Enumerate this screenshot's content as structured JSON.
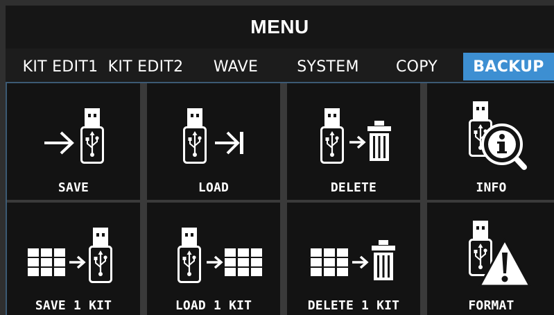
{
  "header": {
    "title": "MENU"
  },
  "tabs": [
    {
      "label": "KIT EDIT1",
      "active": false
    },
    {
      "label": "KIT EDIT2",
      "active": false
    },
    {
      "label": "WAVE",
      "active": false
    },
    {
      "label": "SYSTEM",
      "active": false
    },
    {
      "label": "COPY",
      "active": false
    },
    {
      "label": "BACKUP",
      "active": true
    }
  ],
  "tiles": [
    {
      "label": "SAVE",
      "icon": "usb-save-icon"
    },
    {
      "label": "LOAD",
      "icon": "usb-load-icon"
    },
    {
      "label": "DELETE",
      "icon": "usb-delete-icon"
    },
    {
      "label": "INFO",
      "icon": "usb-info-icon"
    },
    {
      "label": "SAVE 1 KIT",
      "icon": "save-kit-to-usb-icon"
    },
    {
      "label": "LOAD 1 KIT",
      "icon": "load-kit-from-usb-icon"
    },
    {
      "label": "DELETE 1 KIT",
      "icon": "delete-kit-icon"
    },
    {
      "label": "FORMAT",
      "icon": "usb-format-warning-icon"
    }
  ],
  "colors": {
    "active_tab": "#3d8fd2",
    "tile_bg": "#131313",
    "text": "#ffffff"
  }
}
